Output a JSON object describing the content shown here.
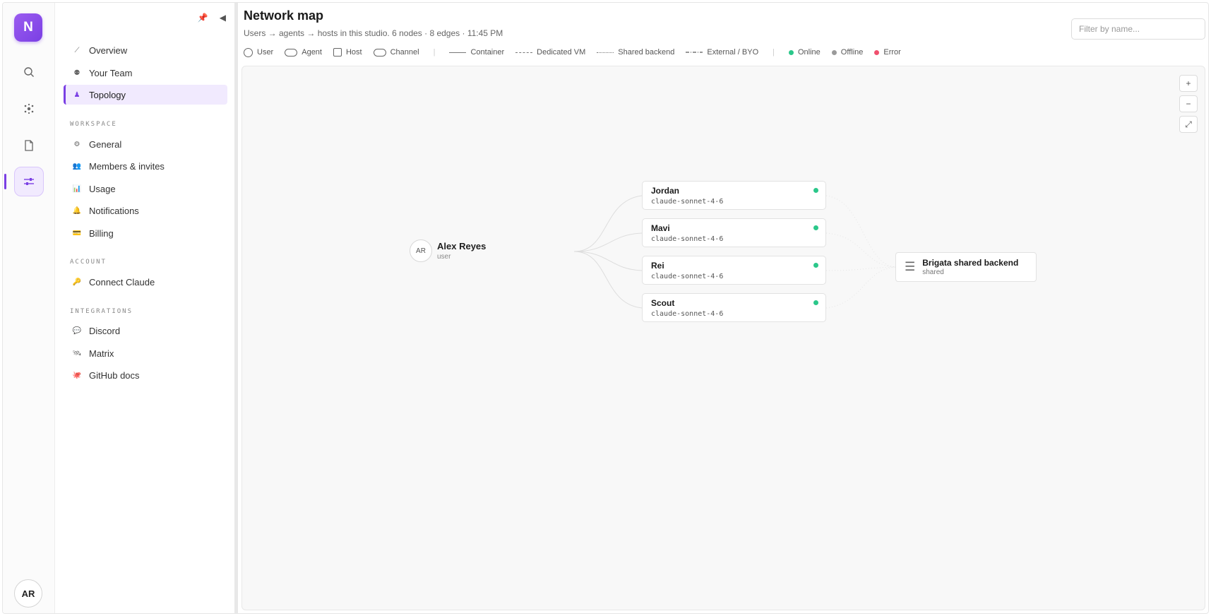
{
  "app": {
    "logo_letter": "N",
    "user_initials": "AR"
  },
  "colors": {
    "accent": "#7a3fe4",
    "online": "#2bc78a",
    "offline": "#9a9a9a",
    "error": "#f0506e"
  },
  "rail": {
    "items": [
      {
        "icon": "search-icon"
      },
      {
        "icon": "network-icon"
      },
      {
        "icon": "document-icon"
      },
      {
        "icon": "sliders-icon",
        "active": true
      }
    ]
  },
  "sidebar": {
    "top_nav": [
      {
        "label": "Overview",
        "icon": "chart-icon"
      },
      {
        "label": "Your Team",
        "icon": "team-icon"
      },
      {
        "label": "Topology",
        "icon": "topology-icon",
        "active": true
      }
    ],
    "workspace_label": "WORKSPACE",
    "workspace": [
      {
        "label": "General",
        "icon": "gear-icon"
      },
      {
        "label": "Members & invites",
        "icon": "people-icon"
      },
      {
        "label": "Usage",
        "icon": "bar-chart-icon"
      },
      {
        "label": "Notifications",
        "icon": "bell-icon"
      },
      {
        "label": "Billing",
        "icon": "credit-card-icon"
      }
    ],
    "account_label": "ACCOUNT",
    "account": [
      {
        "label": "Connect Claude",
        "icon": "key-icon"
      }
    ],
    "integrations_label": "INTEGRATIONS",
    "integrations": [
      {
        "label": "Discord",
        "icon": "chat-icon"
      },
      {
        "label": "Matrix",
        "icon": "satellite-icon"
      },
      {
        "label": "GitHub docs",
        "icon": "octopus-icon"
      }
    ]
  },
  "header": {
    "title": "Network map",
    "subtitle": "Users → agents → hosts in this studio. 6 nodes · 8 edges · 11:45 PM",
    "filter_placeholder": "Filter by name..."
  },
  "legend": {
    "shapes": [
      "User",
      "Agent",
      "Host",
      "Channel"
    ],
    "lines": [
      "Container",
      "Dedicated VM",
      "Shared backend",
      "External / BYO"
    ],
    "status": [
      "Online",
      "Offline",
      "Error"
    ]
  },
  "zoom": {
    "in": "+",
    "out": "−",
    "fit": "⤢"
  },
  "graph": {
    "user": {
      "initials": "AR",
      "name": "Alex Reyes",
      "role": "user"
    },
    "agents": [
      {
        "name": "Jordan",
        "model": "claude-sonnet-4-6",
        "status": "online"
      },
      {
        "name": "Mavi",
        "model": "claude-sonnet-4-6",
        "status": "online"
      },
      {
        "name": "Rei",
        "model": "claude-sonnet-4-6",
        "status": "online"
      },
      {
        "name": "Scout",
        "model": "claude-sonnet-4-6",
        "status": "online"
      }
    ],
    "host": {
      "name": "Brigata shared backend",
      "kind": "shared"
    }
  }
}
